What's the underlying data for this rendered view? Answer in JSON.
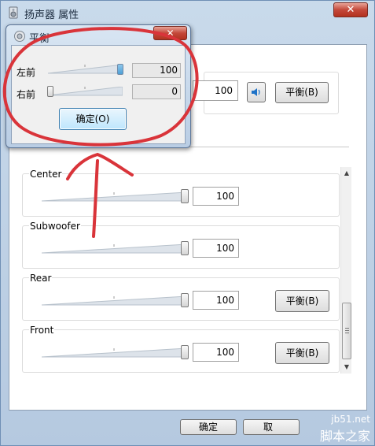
{
  "window": {
    "title": "扬声器 属性",
    "close_glyph": "✕"
  },
  "top_level": {
    "value": "100",
    "balance_label": "平衡(B)"
  },
  "channels": [
    {
      "name": "Center",
      "value": "100",
      "level": 1.0,
      "has_balance": false
    },
    {
      "name": "Subwoofer",
      "value": "100",
      "level": 1.0,
      "has_balance": false
    },
    {
      "name": "Rear",
      "value": "100",
      "level": 1.0,
      "has_balance": true,
      "balance_label": "平衡(B)"
    },
    {
      "name": "Front",
      "value": "100",
      "level": 1.0,
      "has_balance": true,
      "balance_label": "平衡(B)"
    }
  ],
  "footer": {
    "ok_label": "确定",
    "cancel_label": "取"
  },
  "balance_dialog": {
    "title": "平衡",
    "close_glyph": "✕",
    "left_label": "左前",
    "left_value": "100",
    "left_level": 1.0,
    "right_label": "右前",
    "right_value": "0",
    "right_level": 0.0,
    "ok_label": "确定(O)"
  },
  "watermark": {
    "url": "jb51.net",
    "name": "脚本之家"
  },
  "colors": {
    "annotation_red": "#d9343a",
    "thumb_active": "#8ec6ea"
  }
}
